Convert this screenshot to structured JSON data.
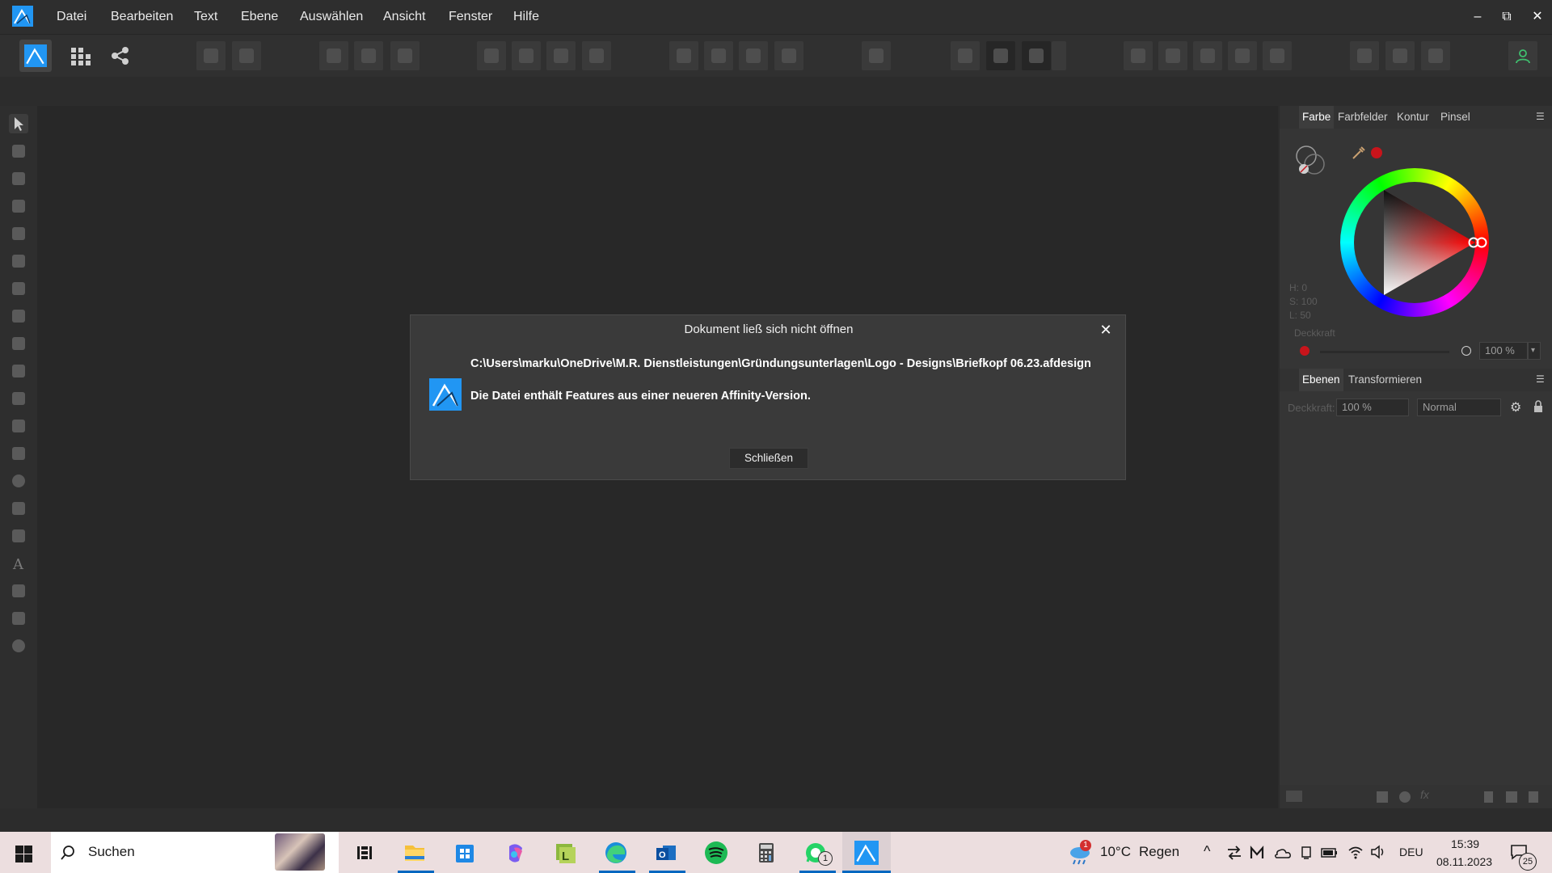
{
  "menu": {
    "items": [
      "Datei",
      "Bearbeiten",
      "Text",
      "Ebene",
      "Auswählen",
      "Ansicht",
      "Fenster",
      "Hilfe"
    ]
  },
  "window_controls": {
    "minimize": "–",
    "maximize": "⧉",
    "close": "✕"
  },
  "color_panel": {
    "tabs": [
      "Farbe",
      "Farbfelder",
      "Kontur",
      "Pinsel"
    ],
    "hsl_h": "H: 0",
    "hsl_s": "S: 100",
    "hsl_l": "L: 50",
    "opacity_label": "Deckkraft",
    "opacity_value": "100 %",
    "fill_color": "#c8141b"
  },
  "layers_panel": {
    "tabs": [
      "Ebenen",
      "Transformieren"
    ],
    "opacity_label": "Deckkraft:",
    "opacity_value": "100 %",
    "blend_mode": "Normal"
  },
  "dialog": {
    "title": "Dokument ließ sich nicht öffnen",
    "path": "C:\\Users\\marku\\OneDrive\\M.R. Dienstleistungen\\Gründungsunterlagen\\Logo - Designs\\Briefkopf 06.23.afdesign",
    "message": "Die Datei enthält Features aus einer neueren Affinity-Version.",
    "button": "Schließen"
  },
  "taskbar": {
    "search_placeholder": "Suchen",
    "weather_temp": "10°C",
    "weather_desc": "Regen",
    "weather_badge": "1",
    "language": "DEU",
    "time": "15:39",
    "date": "08.11.2023",
    "notifications": "25",
    "whatsapp_badge": "1"
  },
  "colors": {
    "accent": "#2196f3",
    "taskbar_bg": "#ecdedf"
  }
}
